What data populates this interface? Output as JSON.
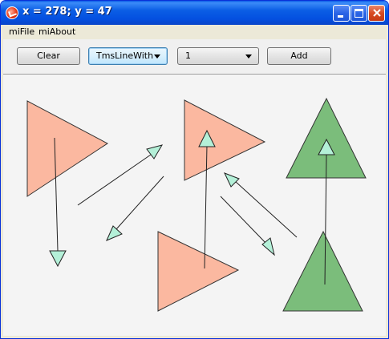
{
  "window": {
    "title": "x = 278; y = 47"
  },
  "menu": {
    "items": [
      "miFile",
      "miAbout"
    ]
  },
  "toolbar": {
    "clear_label": "Clear",
    "tool_selected": "TmsLineWith",
    "count_selected": "1",
    "add_label": "Add"
  },
  "colors": {
    "salmon_fill": "#fbb8a0",
    "green_fill": "#7bbd7b",
    "arrow_head_fill": "#b4f0d8"
  }
}
